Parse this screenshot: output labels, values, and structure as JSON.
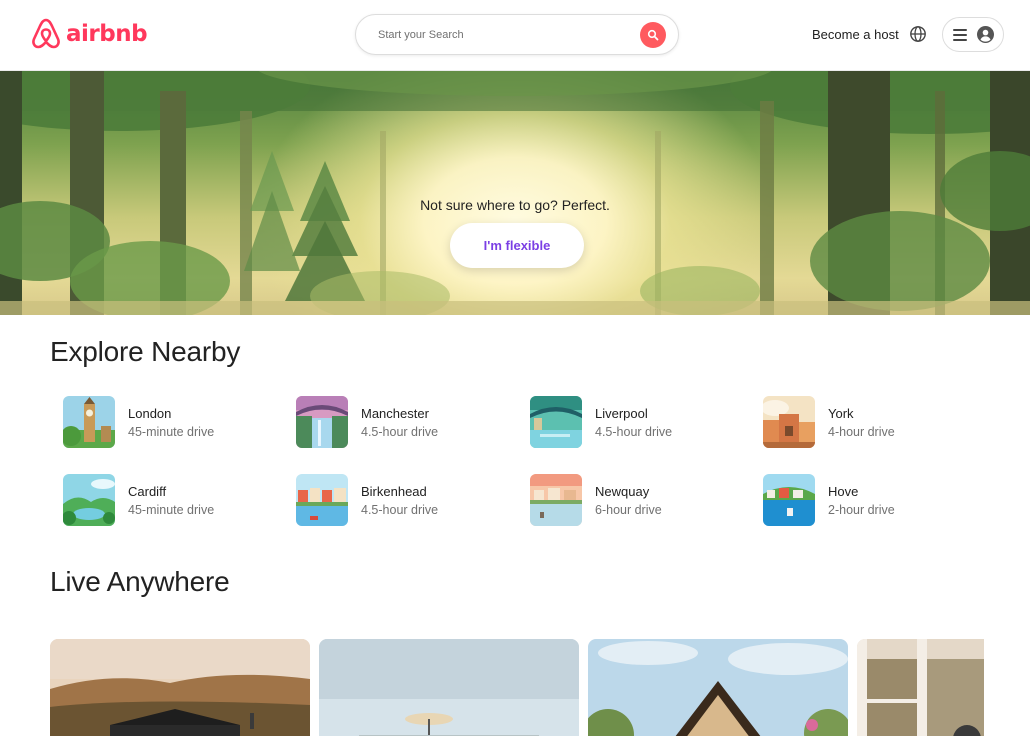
{
  "header": {
    "logo_text": "airbnb",
    "search_placeholder": "Start your Search",
    "host_link": "Become a host",
    "icons": [
      "airbnb-logo-icon",
      "search-icon",
      "globe-icon",
      "menu-icon",
      "user-avatar-icon"
    ],
    "brand_color": "#ff385c",
    "search_button_color": "#ff5a5f"
  },
  "hero": {
    "tagline": "Not sure where to go? Perfect.",
    "button_label": "I'm flexible",
    "button_text_color": "#7b3fe4"
  },
  "explore": {
    "title": "Explore Nearby",
    "items": [
      {
        "city": "London",
        "drive": "45-minute drive"
      },
      {
        "city": "Manchester",
        "drive": "4.5-hour drive"
      },
      {
        "city": "Liverpool",
        "drive": "4.5-hour drive"
      },
      {
        "city": "York",
        "drive": "4-hour drive"
      },
      {
        "city": "Cardiff",
        "drive": "45-minute drive"
      },
      {
        "city": "Birkenhead",
        "drive": "4.5-hour drive"
      },
      {
        "city": "Newquay",
        "drive": "6-hour drive"
      },
      {
        "city": "Hove",
        "drive": "2-hour drive"
      }
    ]
  },
  "live": {
    "title": "Live Anywhere"
  }
}
